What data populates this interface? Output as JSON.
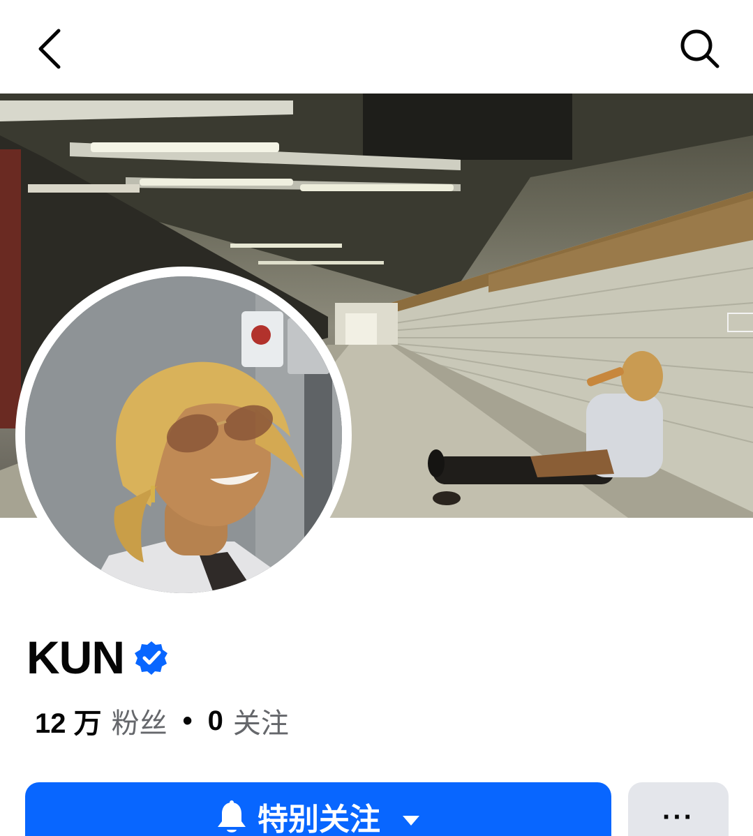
{
  "header": {
    "back_icon": "chevron-left-icon",
    "search_icon": "search-icon"
  },
  "profile": {
    "name": "KUN",
    "verified_icon": "verified-badge-icon",
    "followers_count": "12 万",
    "followers_label": "粉丝",
    "separator": "•",
    "following_count": "0",
    "following_label": "关注"
  },
  "actions": {
    "follow_label": "特别关注",
    "follow_icon": "bell-icon",
    "dropdown_icon": "caret-down-icon",
    "more_label": "···"
  },
  "colors": {
    "accent": "#0866ff",
    "secondary_button": "#e4e6eb",
    "muted_text": "#65676b"
  }
}
